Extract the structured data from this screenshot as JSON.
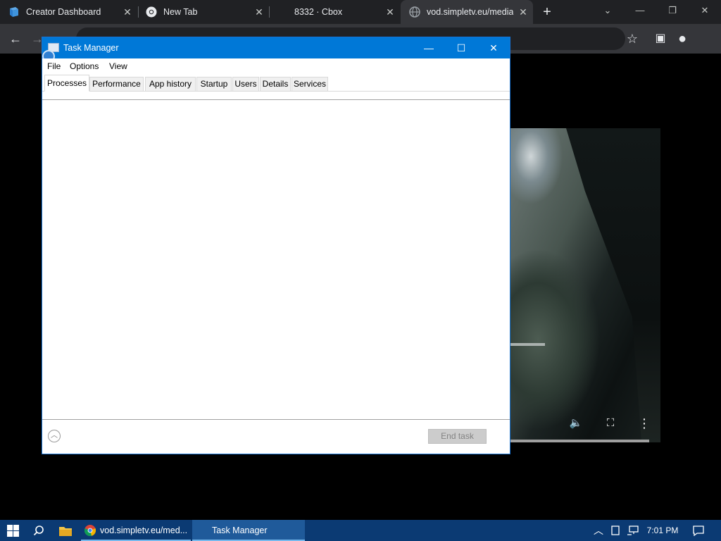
{
  "browser": {
    "tabs": [
      {
        "title": "Creator Dashboard",
        "icon": "creator-dashboard-icon"
      },
      {
        "title": "New Tab",
        "icon": "chrome-icon"
      },
      {
        "title": "8332 · Cbox",
        "icon": ""
      },
      {
        "title": "vod.simpletv.eu/media",
        "icon": "globe-icon"
      }
    ],
    "new_tab_symbol": "+",
    "window_controls": {
      "tab_search": "⌄",
      "minimize": "—",
      "restore": "❐",
      "close": "✕"
    },
    "toolbar": {
      "back": "←",
      "forward": "→",
      "share": "⇪",
      "star": "☆",
      "sidebar": "▣",
      "profile": "●"
    }
  },
  "task_manager": {
    "title": "Task Manager",
    "title_buttons": {
      "minimize": "—",
      "maximize": "☐",
      "close": "✕"
    },
    "menu": [
      "File",
      "Options",
      "View"
    ],
    "tabs": [
      "Processes",
      "Performance",
      "App history",
      "Startup",
      "Users",
      "Details",
      "Services"
    ],
    "selected_tab": "Processes",
    "end_task_label": "End task",
    "fewer_details_symbol": "︿"
  },
  "video_controls": {
    "volume": "🔈",
    "fullscreen": "⛶",
    "more": "⋮",
    "progress": 0.0
  },
  "taskbar": {
    "start": "⊞",
    "search": "⌕",
    "items": [
      {
        "label": "vod.simpletv.eu/med...",
        "icon": "chrome-icon"
      },
      {
        "label": "Task Manager",
        "icon": "task-manager-icon"
      }
    ],
    "tray": {
      "chevron": "︿",
      "clock": "7:01 PM",
      "notifications": "🗨"
    }
  },
  "colors": {
    "titlebar": "#0078d7",
    "taskbar": "#0b3a73",
    "chrome_dark": "#202124",
    "chrome_tab": "#35363a"
  }
}
